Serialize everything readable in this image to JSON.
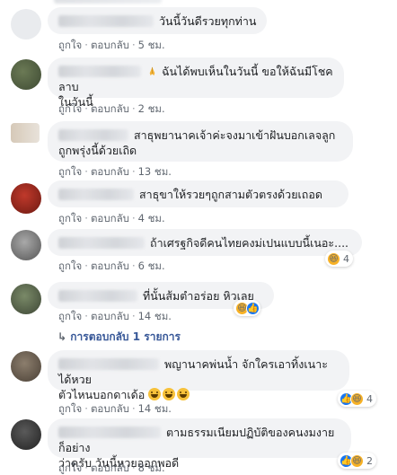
{
  "comments": [
    {
      "text": "วันนี้วันดีรวยทุกท่าน",
      "actions": {
        "like": "ถูกใจ",
        "reply": "ตอบกลับ",
        "time": "5 ชม."
      }
    },
    {
      "text": "ฉันได้พบเห็นในวันนี้ ขอให้ฉันมีโชคลาบ",
      "text2": "ในวันนี้",
      "actions": {
        "like": "ถูกใจ",
        "reply": "ตอบกลับ",
        "time": "2 ชม."
      }
    },
    {
      "text": "สาธุพยานาคเจ้าค่ะจงมาเข้าฝันบอกเลจลูก",
      "text2": "ถูกพรุ่งนี้ด้วยเถิด",
      "actions": {
        "like": "ถูกใจ",
        "reply": "ตอบกลับ",
        "time": "13 ชม."
      }
    },
    {
      "text": "สาธุขาให้รวยๆถูกสามตัวตรงด้วยเถอด",
      "actions": {
        "like": "ถูกใจ",
        "reply": "ตอบกลับ",
        "time": "4 ชม."
      }
    },
    {
      "text": "ถ้าเศรฐกิจดีคนไทยคงม่เปนแบบนี้เนอะ....",
      "actions": {
        "like": "ถูกใจ",
        "reply": "ตอบกลับ",
        "time": "6 ชม."
      },
      "reaction_count": "4"
    },
    {
      "text": "ที่นั้นส้มตำอร่อย หิวเลย",
      "actions": {
        "like": "ถูกใจ",
        "reply": "ตอบกลับ",
        "time": "14 ชม."
      },
      "reply_link": "การตอบกลับ 1 รายการ"
    },
    {
      "text": "พญานาคพ่นน้ำ จักใครเอาทิ้งเนาะ ได้หวย",
      "text2": "ตัวไหนบอกดาเด้อ",
      "actions": {
        "like": "ถูกใจ",
        "reply": "ตอบกลับ",
        "time": "14 ชม."
      },
      "reaction_count": "4"
    },
    {
      "text": "ตามธรรมเนียมปฏิบัติของคนงมงายก็อย่าง",
      "text2": "ว่าครับ วันนี้หวยออกพอดี",
      "actions": {
        "like": "ถูกใจ",
        "reply": "ตอบกลับ",
        "time": "8 ชม."
      },
      "reaction_count": "2"
    }
  ],
  "colors": {
    "bubble": "#f2f3f5",
    "link": "#385898",
    "meta": "#606770",
    "like_blue": "#1877f2",
    "haha_yellow": "#f7b125"
  },
  "icons": [
    "pray-emoji-icon",
    "grin-emoji-icon",
    "haha-reaction-icon",
    "like-reaction-icon",
    "reply-arrow-icon"
  ]
}
